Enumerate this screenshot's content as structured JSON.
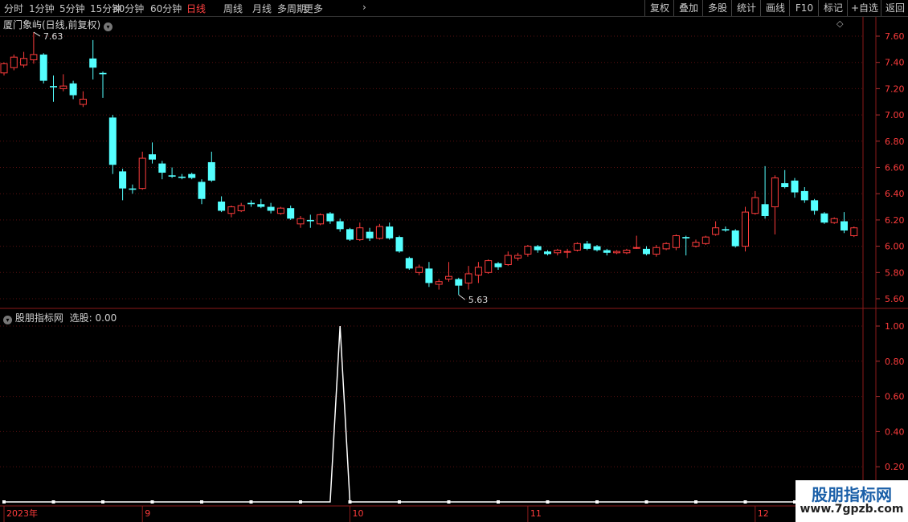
{
  "toolbar": {
    "periods": [
      {
        "label": "分时",
        "active": false
      },
      {
        "label": "1分钟",
        "active": false
      },
      {
        "label": "5分钟",
        "active": false
      },
      {
        "label": "15分钟",
        "active": false
      },
      {
        "label": "30分钟",
        "active": false
      },
      {
        "label": "60分钟",
        "active": false
      },
      {
        "label": "日线",
        "active": true
      },
      {
        "label": "周线",
        "active": false
      },
      {
        "label": "月线",
        "active": false
      },
      {
        "label": "多周期",
        "active": false
      },
      {
        "label": "更多",
        "active": false
      }
    ],
    "actions": [
      "复权",
      "叠加",
      "多股",
      "统计",
      "画线",
      "F10",
      "标记",
      "+自选",
      "返回"
    ]
  },
  "main_panel": {
    "title": "厦门象屿(日线,前复权)",
    "diamond_icon": "diamond-icon"
  },
  "indicator_panel": {
    "title": "股朋指标网",
    "value_label": "选股: 0.00"
  },
  "watermark": {
    "title": "股朋指标网",
    "url": "www.7gpzb.com"
  },
  "colors": {
    "up": "#ff3c3c",
    "down": "#54ffff",
    "grid": "#5a1010",
    "border": "#8b1a1a",
    "indicator_line": "#ffffff",
    "bg": "#000000"
  },
  "chart_data": [
    {
      "type": "candlestick",
      "y_ticks": [
        "7.60",
        "7.40",
        "7.20",
        "7.00",
        "6.80",
        "6.60",
        "6.40",
        "6.20",
        "6.00",
        "5.80",
        "5.60"
      ],
      "ylim": [
        5.55,
        7.7
      ],
      "annotations": {
        "high_label": "7.63",
        "low_label": "5.63"
      },
      "x_labels": [
        {
          "label": "2023年",
          "index": 0
        },
        {
          "label": "9",
          "index": 14
        },
        {
          "label": "10",
          "index": 35
        },
        {
          "label": "11",
          "index": 53
        },
        {
          "label": "12",
          "index": 76
        }
      ],
      "candles": [
        [
          7.32,
          7.39,
          7.3,
          7.4
        ],
        [
          7.36,
          7.44,
          7.34,
          7.46
        ],
        [
          7.38,
          7.43,
          7.36,
          7.48
        ],
        [
          7.42,
          7.46,
          7.39,
          7.63
        ],
        [
          7.46,
          7.26,
          7.24,
          7.47
        ],
        [
          7.22,
          7.21,
          7.1,
          7.3
        ],
        [
          7.2,
          7.22,
          7.18,
          7.31
        ],
        [
          7.24,
          7.15,
          7.12,
          7.26
        ],
        [
          7.08,
          7.12,
          7.06,
          7.18
        ],
        [
          7.43,
          7.36,
          7.27,
          7.57
        ],
        [
          7.32,
          7.31,
          7.13,
          7.33
        ],
        [
          6.98,
          6.62,
          6.55,
          7.0
        ],
        [
          6.57,
          6.44,
          6.35,
          6.59
        ],
        [
          6.44,
          6.43,
          6.4,
          6.47
        ],
        [
          6.44,
          6.67,
          6.43,
          6.72
        ],
        [
          6.7,
          6.66,
          6.63,
          6.79
        ],
        [
          6.63,
          6.56,
          6.51,
          6.65
        ],
        [
          6.54,
          6.53,
          6.52,
          6.6
        ],
        [
          6.53,
          6.52,
          6.51,
          6.55
        ],
        [
          6.55,
          6.52,
          6.51,
          6.56
        ],
        [
          6.49,
          6.36,
          6.32,
          6.51
        ],
        [
          6.64,
          6.5,
          6.49,
          6.72
        ],
        [
          6.34,
          6.27,
          6.26,
          6.38
        ],
        [
          6.25,
          6.3,
          6.22,
          6.31
        ],
        [
          6.27,
          6.31,
          6.26,
          6.33
        ],
        [
          6.33,
          6.32,
          6.3,
          6.35
        ],
        [
          6.32,
          6.3,
          6.29,
          6.36
        ],
        [
          6.3,
          6.27,
          6.25,
          6.33
        ],
        [
          6.25,
          6.29,
          6.24,
          6.3
        ],
        [
          6.29,
          6.21,
          6.2,
          6.31
        ],
        [
          6.17,
          6.21,
          6.14,
          6.23
        ],
        [
          6.2,
          6.19,
          6.14,
          6.24
        ],
        [
          6.17,
          6.24,
          6.16,
          6.25
        ],
        [
          6.25,
          6.19,
          6.17,
          6.26
        ],
        [
          6.19,
          6.13,
          6.11,
          6.21
        ],
        [
          6.13,
          6.05,
          6.04,
          6.14
        ],
        [
          6.05,
          6.14,
          6.04,
          6.18
        ],
        [
          6.11,
          6.06,
          6.04,
          6.14
        ],
        [
          6.06,
          6.15,
          6.05,
          6.17
        ],
        [
          6.15,
          6.06,
          6.05,
          6.18
        ],
        [
          6.07,
          5.96,
          5.95,
          6.08
        ],
        [
          5.91,
          5.83,
          5.82,
          5.92
        ],
        [
          5.8,
          5.84,
          5.78,
          5.86
        ],
        [
          5.83,
          5.72,
          5.69,
          5.88
        ],
        [
          5.71,
          5.73,
          5.67,
          5.75
        ],
        [
          5.75,
          5.77,
          5.73,
          5.88
        ],
        [
          5.75,
          5.7,
          5.63,
          5.76
        ],
        [
          5.72,
          5.79,
          5.67,
          5.85
        ],
        [
          5.78,
          5.84,
          5.72,
          5.88
        ],
        [
          5.8,
          5.89,
          5.79,
          5.9
        ],
        [
          5.87,
          5.84,
          5.82,
          5.88
        ],
        [
          5.86,
          5.93,
          5.85,
          5.96
        ],
        [
          5.91,
          5.93,
          5.89,
          5.95
        ],
        [
          5.94,
          6.0,
          5.92,
          6.01
        ],
        [
          6.0,
          5.97,
          5.95,
          6.01
        ],
        [
          5.96,
          5.94,
          5.93,
          5.97
        ],
        [
          5.95,
          5.97,
          5.93,
          5.98
        ],
        [
          5.96,
          5.96,
          5.91,
          5.98
        ],
        [
          5.97,
          6.02,
          5.96,
          6.03
        ],
        [
          6.02,
          5.98,
          5.97,
          6.04
        ],
        [
          6.0,
          5.97,
          5.96,
          6.01
        ],
        [
          5.97,
          5.95,
          5.93,
          5.98
        ],
        [
          5.95,
          5.96,
          5.94,
          5.97
        ],
        [
          5.95,
          5.97,
          5.94,
          5.98
        ],
        [
          5.99,
          5.99,
          5.98,
          6.08
        ],
        [
          5.98,
          5.94,
          5.93,
          6.0
        ],
        [
          5.94,
          5.99,
          5.92,
          6.01
        ],
        [
          5.98,
          6.02,
          5.97,
          6.03
        ],
        [
          5.99,
          6.08,
          5.97,
          6.09
        ],
        [
          6.07,
          6.06,
          5.93,
          6.08
        ],
        [
          6.0,
          6.03,
          5.99,
          6.05
        ],
        [
          6.02,
          6.07,
          6.01,
          6.08
        ],
        [
          6.09,
          6.14,
          6.08,
          6.19
        ],
        [
          6.13,
          6.12,
          6.11,
          6.15
        ],
        [
          6.12,
          6.0,
          5.99,
          6.13
        ],
        [
          6.0,
          6.26,
          5.96,
          6.3
        ],
        [
          6.25,
          6.37,
          6.24,
          6.42
        ],
        [
          6.32,
          6.23,
          6.21,
          6.61
        ],
        [
          6.3,
          6.52,
          6.09,
          6.54
        ],
        [
          6.48,
          6.45,
          6.44,
          6.58
        ],
        [
          6.5,
          6.41,
          6.37,
          6.52
        ],
        [
          6.42,
          6.35,
          6.33,
          6.45
        ],
        [
          6.35,
          6.27,
          6.24,
          6.36
        ],
        [
          6.25,
          6.18,
          6.17,
          6.26
        ],
        [
          6.18,
          6.21,
          6.17,
          6.22
        ],
        [
          6.19,
          6.12,
          6.1,
          6.26
        ],
        [
          6.08,
          6.14,
          6.07,
          6.15
        ]
      ]
    },
    {
      "type": "line",
      "y_ticks": [
        "1.00",
        "0.80",
        "0.60",
        "0.40",
        "0.20"
      ],
      "ylim": [
        0.0,
        1.1
      ],
      "x_markers": [
        0,
        5,
        10,
        15,
        20,
        25,
        30,
        35,
        40,
        45,
        50,
        55,
        60,
        65,
        70,
        75,
        80,
        85
      ],
      "series": [
        {
          "values": [
            0,
            0,
            0,
            0,
            0,
            0,
            0,
            0,
            0,
            0,
            0,
            0,
            0,
            0,
            0,
            0,
            0,
            0,
            0,
            0,
            0,
            0,
            0,
            0,
            0,
            0,
            0,
            0,
            0,
            0,
            0,
            0,
            0,
            0,
            1,
            0,
            0,
            0,
            0,
            0,
            0,
            0,
            0,
            0,
            0,
            0,
            0,
            0,
            0,
            0,
            0,
            0,
            0,
            0,
            0,
            0,
            0,
            0,
            0,
            0,
            0,
            0,
            0,
            0,
            0,
            0,
            0,
            0,
            0,
            0,
            0,
            0,
            0,
            0,
            0,
            0,
            0,
            0,
            0,
            0,
            0,
            0,
            0,
            0,
            0,
            0,
            0
          ]
        }
      ]
    }
  ]
}
